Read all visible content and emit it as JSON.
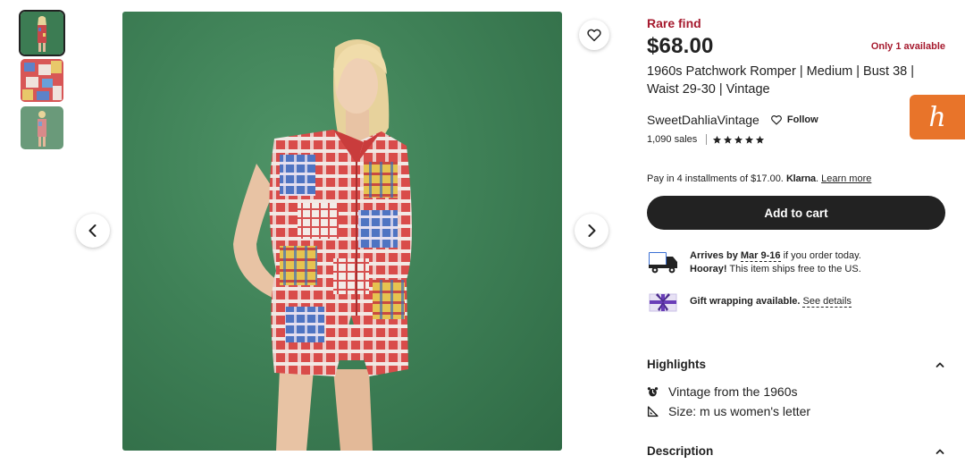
{
  "gallery": {
    "thumbnails": [
      {
        "name": "thumbnail-1",
        "active": true
      },
      {
        "name": "thumbnail-2",
        "active": false
      },
      {
        "name": "thumbnail-3",
        "active": false
      }
    ],
    "prev_icon": "chevron-left-icon",
    "next_icon": "chevron-right-icon",
    "favorite_icon": "heart-icon"
  },
  "listing": {
    "badge": "Rare find",
    "price": "$68.00",
    "stock": "Only 1 available",
    "title": "1960s Patchwork Romper | Medium | Bust 38 | Waist 29-30 | Vintage",
    "shop_name": "SweetDahliaVintage",
    "follow_label": "Follow",
    "sales": "1,090 sales",
    "rating_stars": 5,
    "klarna_prefix": "Pay in 4 installments of $17.00.",
    "klarna_brand": "Klarna",
    "klarna_dot": ".",
    "klarna_link": "Learn more",
    "add_to_cart": "Add to cart"
  },
  "shipping": {
    "arrives_label": "Arrives by",
    "dates": "Mar 9-16",
    "order_text": "if you order today.",
    "hooray": "Hooray!",
    "free_text": "This item ships free to the US."
  },
  "gift": {
    "text": "Gift wrapping available.",
    "link": "See details"
  },
  "highlights": {
    "heading": "Highlights",
    "items": [
      {
        "icon": "alarm-clock-icon",
        "text": "Vintage from the 1960s"
      },
      {
        "icon": "ruler-triangle-icon",
        "text": "Size: m us women's letter"
      }
    ]
  },
  "description": {
    "heading": "Description"
  },
  "honey": {
    "glyph": "h"
  },
  "colors": {
    "accent_red": "#a61a2e",
    "button_dark": "#222222",
    "honey_orange": "#e8742a",
    "photo_green": "#3f8157"
  }
}
